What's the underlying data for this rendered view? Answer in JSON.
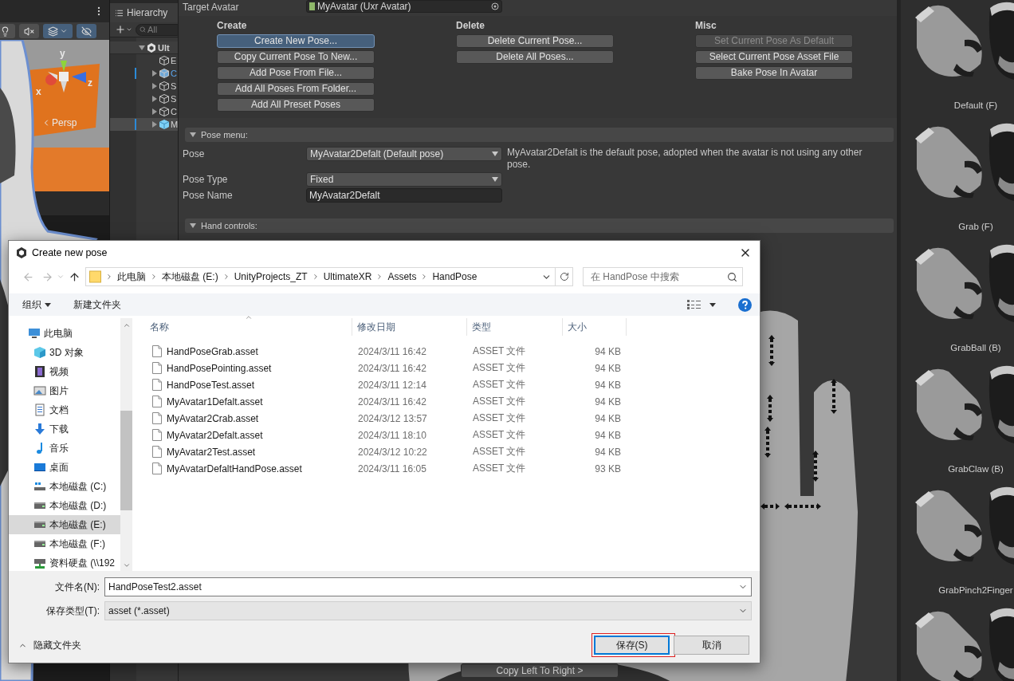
{
  "scene_view": {
    "toggles": [
      {
        "kind": "lighting",
        "on": false
      },
      {
        "kind": "audio",
        "on": false
      },
      {
        "kind": "effects",
        "on": true
      },
      {
        "kind": "visibility",
        "on": true
      }
    ],
    "gizmo": {
      "axes": [
        "y",
        "x",
        "z"
      ],
      "projection": "Persp"
    }
  },
  "hierarchy": {
    "title": "Hierarchy",
    "search": {
      "placeholder": "All"
    },
    "tree": [
      {
        "label": "Ult",
        "kind": "scene",
        "expanded": true,
        "selected": false,
        "children": [
          {
            "label": "E",
            "kind": "object",
            "selected": false
          },
          {
            "label": "C",
            "kind": "prefab",
            "expanded": false,
            "selected": false
          },
          {
            "label": "S",
            "kind": "group",
            "expanded": false,
            "selected": false
          },
          {
            "label": "S",
            "kind": "group",
            "expanded": false,
            "selected": false
          },
          {
            "label": "C",
            "kind": "group",
            "expanded": false,
            "selected": false
          },
          {
            "label": "M",
            "kind": "avatar",
            "expanded": false,
            "selected": true
          }
        ]
      }
    ]
  },
  "inspector": {
    "target_avatar": {
      "label": "Target Avatar",
      "value": "MyAvatar (Uxr Avatar)"
    },
    "action_groups": [
      {
        "title": "Create",
        "buttons": [
          {
            "label": "Create New Pose...",
            "selected": true,
            "disabled": false
          },
          {
            "label": "Copy Current Pose To New...",
            "selected": false,
            "disabled": false
          },
          {
            "label": "Add Pose From File...",
            "selected": false,
            "disabled": false
          },
          {
            "label": "Add All Poses From Folder...",
            "selected": false,
            "disabled": false
          },
          {
            "label": "Add All Preset Poses",
            "selected": false,
            "disabled": false
          }
        ]
      },
      {
        "title": "Delete",
        "buttons": [
          {
            "label": "Delete Current Pose...",
            "selected": false,
            "disabled": false
          },
          {
            "label": "Delete All Poses...",
            "selected": false,
            "disabled": false
          }
        ]
      },
      {
        "title": "Misc",
        "buttons": [
          {
            "label": "Set Current Pose As Default",
            "selected": false,
            "disabled": true
          },
          {
            "label": "Select Current Pose Asset File",
            "selected": false,
            "disabled": false
          },
          {
            "label": "Bake Pose In Avatar",
            "selected": false,
            "disabled": false
          }
        ]
      }
    ],
    "pose_menu": {
      "title": "Pose menu:",
      "expanded": true,
      "fields": [
        {
          "label": "Pose",
          "kind": "dropdown",
          "value": "MyAvatar2Defalt (Default pose)",
          "note": "MyAvatar2Defalt is the default pose, adopted when the avatar is not using any other pose."
        },
        {
          "label": "Pose Type",
          "kind": "dropdown",
          "value": "Fixed"
        },
        {
          "label": "Pose Name",
          "kind": "text",
          "value": "MyAvatar2Defalt"
        }
      ]
    },
    "hand_controls": {
      "title": "Hand controls:",
      "expanded": true,
      "copy_button": "Copy Left To Right >"
    }
  },
  "pose_previews": [
    {
      "kind": "picture",
      "label": "Default (F)"
    },
    {
      "kind": "picture",
      "label": "Grab (F)"
    },
    {
      "kind": "picture",
      "label": "GrabBall (B)"
    },
    {
      "kind": "picture",
      "label": "GrabClaw (B)"
    },
    {
      "kind": "picture",
      "label": "GrabPinch2Finger"
    },
    {
      "kind": "picture"
    }
  ],
  "dialog": {
    "title": "Create new pose",
    "breadcrumb": [
      "此电脑",
      "本地磁盘 (E:)",
      "UnityProjects_ZT",
      "UltimateXR",
      "Assets",
      "HandPose"
    ],
    "search": {
      "placeholder": "在 HandPose 中搜索"
    },
    "toolbar": {
      "organize": "组织",
      "new_folder": "新建文件夹"
    },
    "nav": [
      {
        "label": "此电脑",
        "kind": "pc",
        "selected": false,
        "children": [
          {
            "label": "3D 对象",
            "kind": "objects",
            "selected": false
          },
          {
            "label": "视频",
            "kind": "video",
            "selected": false
          },
          {
            "label": "图片",
            "kind": "pictures",
            "selected": false
          },
          {
            "label": "文档",
            "kind": "documents",
            "selected": false
          },
          {
            "label": "下载",
            "kind": "downloads",
            "selected": false
          },
          {
            "label": "音乐",
            "kind": "music",
            "selected": false
          },
          {
            "label": "桌面",
            "kind": "desktop",
            "selected": false
          },
          {
            "label": "本地磁盘 (C:)",
            "kind": "sysdrive",
            "selected": false
          },
          {
            "label": "本地磁盘 (D:)",
            "kind": "drive",
            "selected": false
          },
          {
            "label": "本地磁盘 (E:)",
            "kind": "drive",
            "selected": true
          },
          {
            "label": "本地磁盘 (F:)",
            "kind": "drive",
            "selected": false
          },
          {
            "label": "资料硬盘 (\\\\192",
            "kind": "netdrive",
            "selected": false
          }
        ]
      }
    ],
    "columns": [
      "名称",
      "修改日期",
      "类型",
      "大小"
    ],
    "files": [
      {
        "name": "HandPoseGrab.asset",
        "modified": "2024/3/11 16:42",
        "type": "ASSET 文件",
        "size": "94 KB"
      },
      {
        "name": "HandPosePointing.asset",
        "modified": "2024/3/11 16:42",
        "type": "ASSET 文件",
        "size": "94 KB"
      },
      {
        "name": "HandPoseTest.asset",
        "modified": "2024/3/11 12:14",
        "type": "ASSET 文件",
        "size": "94 KB"
      },
      {
        "name": "MyAvatar1Defalt.asset",
        "modified": "2024/3/11 16:42",
        "type": "ASSET 文件",
        "size": "94 KB"
      },
      {
        "name": "MyAvatar2Crab.asset",
        "modified": "2024/3/12 13:57",
        "type": "ASSET 文件",
        "size": "94 KB"
      },
      {
        "name": "MyAvatar2Defalt.asset",
        "modified": "2024/3/11 18:10",
        "type": "ASSET 文件",
        "size": "94 KB"
      },
      {
        "name": "MyAvatar2Test.asset",
        "modified": "2024/3/12 10:22",
        "type": "ASSET 文件",
        "size": "94 KB"
      },
      {
        "name": "MyAvatarDefaltHandPose.asset",
        "modified": "2024/3/11 16:05",
        "type": "ASSET 文件",
        "size": "93 KB"
      }
    ],
    "file_name": {
      "label": "文件名(N):",
      "value": "HandPoseTest2.asset"
    },
    "file_type": {
      "label": "保存类型(T):",
      "value": "asset (*.asset)"
    },
    "hide_folders": "隐藏文件夹",
    "buttons": [
      {
        "label": "保存(S)",
        "selected": true,
        "annotated": true
      },
      {
        "label": "取消",
        "selected": false,
        "annotated": false
      }
    ]
  }
}
